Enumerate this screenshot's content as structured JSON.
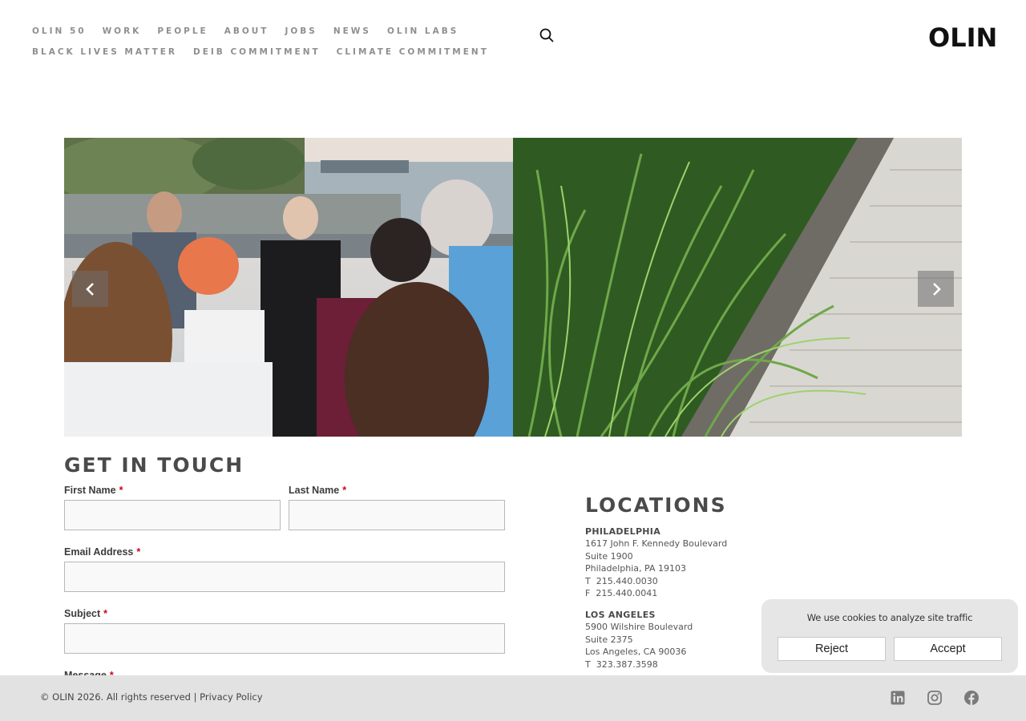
{
  "nav": {
    "row1": [
      "OLIN 50",
      "WORK",
      "PEOPLE",
      "ABOUT",
      "JOBS",
      "NEWS",
      "OLIN LABS"
    ],
    "row2": [
      "BLACK LIVES MATTER",
      "DEIB COMMITMENT",
      "CLIMATE COMMITMENT"
    ]
  },
  "logo": "OLIN",
  "icons": {
    "search": "search-icon",
    "prev": "chevron-left-icon",
    "next": "chevron-right-icon",
    "linkedin": "linkedin-icon",
    "instagram": "instagram-icon",
    "facebook": "facebook-icon"
  },
  "contact": {
    "title": "GET IN TOUCH",
    "required_mark": "*",
    "first_name_label": "First Name",
    "last_name_label": "Last Name",
    "email_label": "Email Address",
    "subject_label": "Subject",
    "message_label": "Message",
    "first_name_value": "",
    "last_name_value": "",
    "email_value": "",
    "subject_value": ""
  },
  "locations": {
    "title": "LOCATIONS",
    "offices": [
      {
        "city": "PHILADELPHIA",
        "address1": "1617 John F. Kennedy Boulevard",
        "address2": "Suite 1900",
        "city_line": "Philadelphia, PA 19103",
        "phone": "T  215.440.0030",
        "fax": "F  215.440.0041"
      },
      {
        "city": "LOS ANGELES",
        "address1": "5900 Wilshire Boulevard",
        "address2": "Suite 2375",
        "city_line": "Los Angeles, CA 90036",
        "phone": "T  323.387.3598"
      }
    ]
  },
  "cookie": {
    "message": "We use cookies to analyze site traffic",
    "reject": "Reject",
    "accept": "Accept"
  },
  "footer": {
    "copyright": "© OLIN 2026. All rights reserved | ",
    "privacy": "Privacy Policy"
  },
  "colors": {
    "nav_text": "#8f8f8f",
    "heading": "#4a4a4a",
    "required": "#d0021b",
    "footer_bg": "#e2e2e2",
    "cookie_bg": "#e6e6e6"
  }
}
